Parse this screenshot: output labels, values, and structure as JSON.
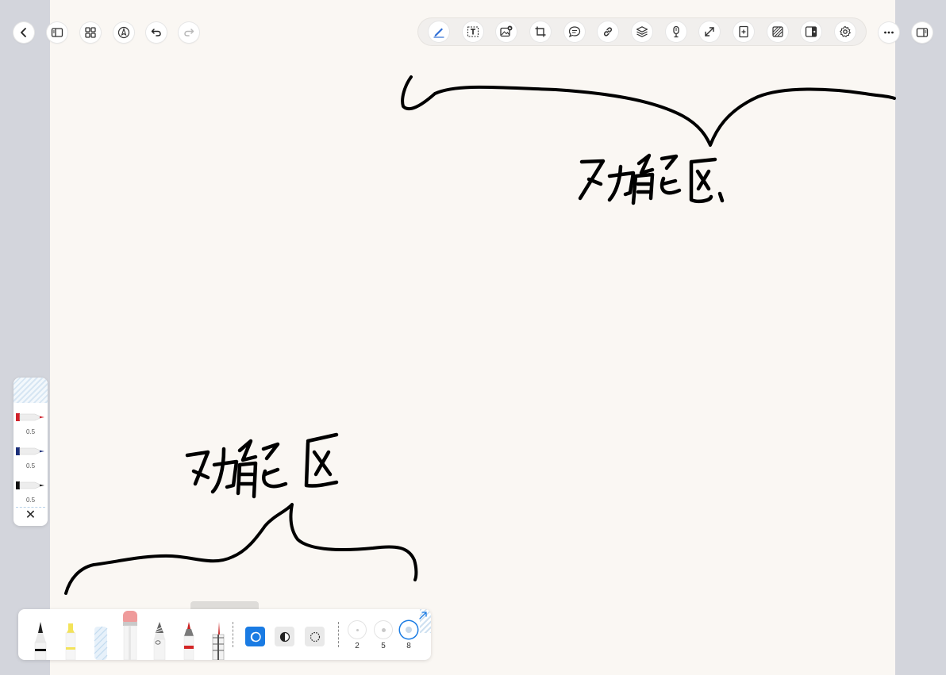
{
  "canvas": {
    "handwriting_top": "功能区",
    "handwriting_bottom": "功能区"
  },
  "nav_left": {
    "buttons": [
      {
        "name": "back-button",
        "icon": "chevron-left-icon"
      },
      {
        "name": "sidebar-toggle-button",
        "icon": "sidebar-icon"
      },
      {
        "name": "page-grid-button",
        "icon": "grid-icon"
      },
      {
        "name": "pen-nib-button",
        "icon": "pen-nib-icon"
      },
      {
        "name": "undo-button",
        "icon": "undo-icon"
      },
      {
        "name": "redo-button",
        "icon": "redo-icon"
      }
    ]
  },
  "toolbar": {
    "active_tool": "pen",
    "tools": [
      {
        "name": "pen-tool",
        "icon": "pen-icon"
      },
      {
        "name": "text-box-tool",
        "icon": "text-box-icon"
      },
      {
        "name": "insert-image-tool",
        "icon": "image-add-icon"
      },
      {
        "name": "crop-tool",
        "icon": "crop-icon"
      },
      {
        "name": "comment-tool",
        "icon": "comment-icon"
      },
      {
        "name": "link-tool",
        "icon": "link-icon"
      },
      {
        "name": "layers-tool",
        "icon": "layers-icon"
      },
      {
        "name": "voice-record-tool",
        "icon": "microphone-icon"
      },
      {
        "name": "fullscreen-tool",
        "icon": "expand-icon"
      },
      {
        "name": "add-page-tool",
        "icon": "page-add-icon"
      },
      {
        "name": "pattern-tool",
        "icon": "hatch-icon"
      },
      {
        "name": "split-view-tool",
        "icon": "split-view-icon"
      },
      {
        "name": "settings-tool",
        "icon": "gear-icon"
      }
    ]
  },
  "nav_right": {
    "more_icon": "more-horizontal-icon",
    "panel_icon": "right-panel-icon"
  },
  "presets": {
    "items": [
      {
        "size": "0.5",
        "color": "#d0202a"
      },
      {
        "size": "0.5",
        "color": "#1b2f7a"
      },
      {
        "size": "0.5",
        "color": "#111111"
      }
    ],
    "close_label": "✕"
  },
  "pen_tray": {
    "tools": [
      "ballpoint-pen",
      "highlighter",
      "eraser",
      "pencil-eraser",
      "fountain-pen",
      "marker-red",
      "ruler-pen"
    ],
    "modes": [
      "fill-mode",
      "contrast-mode",
      "dashed-mode"
    ],
    "active_mode": "fill-mode",
    "sizes": [
      "2",
      "5",
      "8"
    ],
    "selected_size": "8",
    "accent": "#1a7be3"
  }
}
